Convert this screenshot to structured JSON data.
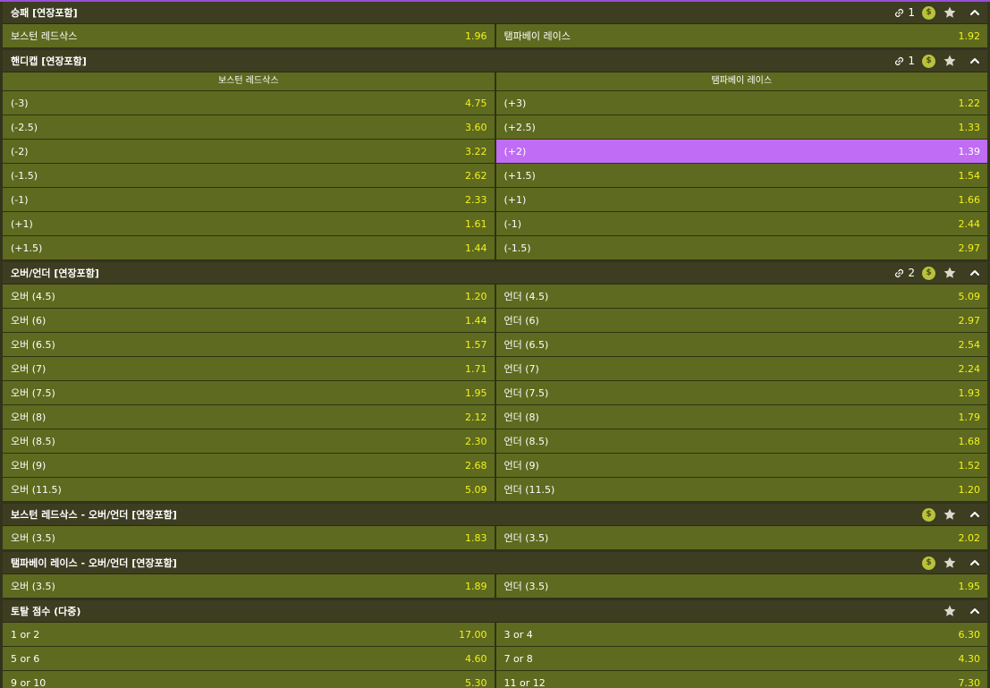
{
  "colors": {
    "header_bg": "#3d3d22",
    "cell_bg": "#5e6a1f",
    "odds_text": "#f2f21c",
    "selected_bg": "#c06cf5",
    "top_border": "#9a4ed8"
  },
  "markets": [
    {
      "title": "승패 [연장포함]",
      "link_count": "1",
      "show_link": true,
      "show_coin": true,
      "show_star": true,
      "columns": null,
      "rows": [
        [
          {
            "label": "보스턴 레드삭스",
            "odds": "1.96"
          },
          {
            "label": "탬파베이 레이스",
            "odds": "1.92"
          }
        ]
      ]
    },
    {
      "title": "핸디캡 [연장포함]",
      "link_count": "1",
      "show_link": true,
      "show_coin": true,
      "show_star": true,
      "columns": [
        "보스턴 레드삭스",
        "탬파베이 레이스"
      ],
      "rows": [
        [
          {
            "label": "(-3)",
            "odds": "4.75"
          },
          {
            "label": "(+3)",
            "odds": "1.22"
          }
        ],
        [
          {
            "label": "(-2.5)",
            "odds": "3.60"
          },
          {
            "label": "(+2.5)",
            "odds": "1.33"
          }
        ],
        [
          {
            "label": "(-2)",
            "odds": "3.22"
          },
          {
            "label": "(+2)",
            "odds": "1.39",
            "selected": true
          }
        ],
        [
          {
            "label": "(-1.5)",
            "odds": "2.62"
          },
          {
            "label": "(+1.5)",
            "odds": "1.54"
          }
        ],
        [
          {
            "label": "(-1)",
            "odds": "2.33"
          },
          {
            "label": "(+1)",
            "odds": "1.66"
          }
        ],
        [
          {
            "label": "(+1)",
            "odds": "1.61"
          },
          {
            "label": "(-1)",
            "odds": "2.44"
          }
        ],
        [
          {
            "label": "(+1.5)",
            "odds": "1.44"
          },
          {
            "label": "(-1.5)",
            "odds": "2.97"
          }
        ]
      ]
    },
    {
      "title": "오버/언더 [연장포함]",
      "link_count": "2",
      "show_link": true,
      "show_coin": true,
      "show_star": true,
      "columns": null,
      "rows": [
        [
          {
            "label": "오버 (4.5)",
            "odds": "1.20"
          },
          {
            "label": "언더 (4.5)",
            "odds": "5.09"
          }
        ],
        [
          {
            "label": "오버 (6)",
            "odds": "1.44"
          },
          {
            "label": "언더 (6)",
            "odds": "2.97"
          }
        ],
        [
          {
            "label": "오버 (6.5)",
            "odds": "1.57"
          },
          {
            "label": "언더 (6.5)",
            "odds": "2.54"
          }
        ],
        [
          {
            "label": "오버 (7)",
            "odds": "1.71"
          },
          {
            "label": "언더 (7)",
            "odds": "2.24"
          }
        ],
        [
          {
            "label": "오버 (7.5)",
            "odds": "1.95"
          },
          {
            "label": "언더 (7.5)",
            "odds": "1.93"
          }
        ],
        [
          {
            "label": "오버 (8)",
            "odds": "2.12"
          },
          {
            "label": "언더 (8)",
            "odds": "1.79"
          }
        ],
        [
          {
            "label": "오버 (8.5)",
            "odds": "2.30"
          },
          {
            "label": "언더 (8.5)",
            "odds": "1.68"
          }
        ],
        [
          {
            "label": "오버 (9)",
            "odds": "2.68"
          },
          {
            "label": "언더 (9)",
            "odds": "1.52"
          }
        ],
        [
          {
            "label": "오버 (11.5)",
            "odds": "5.09"
          },
          {
            "label": "언더 (11.5)",
            "odds": "1.20"
          }
        ]
      ]
    },
    {
      "title": "보스턴 레드삭스 - 오버/언더 [연장포함]",
      "link_count": "",
      "show_link": false,
      "show_coin": true,
      "show_star": true,
      "columns": null,
      "rows": [
        [
          {
            "label": "오버 (3.5)",
            "odds": "1.83"
          },
          {
            "label": "언더 (3.5)",
            "odds": "2.02"
          }
        ]
      ]
    },
    {
      "title": "탬파베이 레이스 - 오버/언더 [연장포함]",
      "link_count": "",
      "show_link": false,
      "show_coin": true,
      "show_star": true,
      "columns": null,
      "rows": [
        [
          {
            "label": "오버 (3.5)",
            "odds": "1.89"
          },
          {
            "label": "언더 (3.5)",
            "odds": "1.95"
          }
        ]
      ]
    },
    {
      "title": "토탈 점수 (다중)",
      "link_count": "",
      "show_link": false,
      "show_coin": false,
      "show_star": true,
      "columns": null,
      "rows": [
        [
          {
            "label": "1 or 2",
            "odds": "17.00"
          },
          {
            "label": "3 or 4",
            "odds": "6.30"
          }
        ],
        [
          {
            "label": "5 or 6",
            "odds": "4.60"
          },
          {
            "label": "7 or 8",
            "odds": "4.30"
          }
        ],
        [
          {
            "label": "9 or 10",
            "odds": "5.30"
          },
          {
            "label": "11 or 12",
            "odds": "7.30"
          }
        ]
      ]
    }
  ],
  "icons": {
    "link": "link-icon",
    "coin": "dollar-coin-icon",
    "star": "star-icon",
    "collapse": "chevron-up-icon",
    "coin_glyph": "$"
  }
}
